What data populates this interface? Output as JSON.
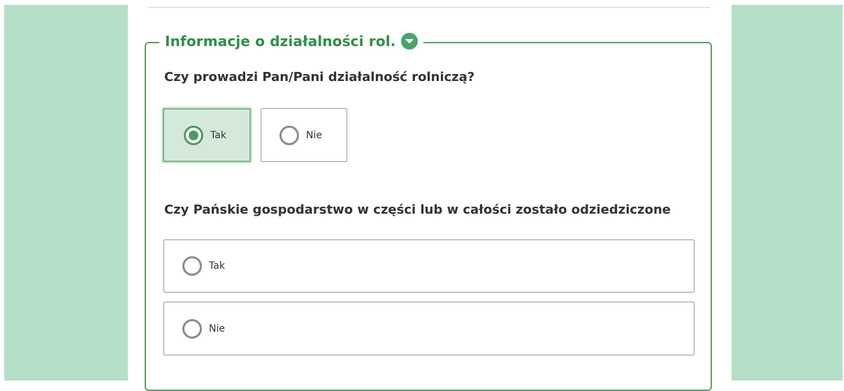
{
  "section": {
    "legend_title": "Informacje o działalności rol."
  },
  "questions": [
    {
      "text": "Czy prowadzi Pan/Pani działalność rolniczą?",
      "options": [
        {
          "label": "Tak",
          "selected": true
        },
        {
          "label": "Nie",
          "selected": false
        }
      ]
    },
    {
      "text": "Czy Pańskie gospodarstwo w części lub w całości zostało odziedziczone",
      "options": [
        {
          "label": "Tak",
          "selected": false
        },
        {
          "label": "Nie",
          "selected": false
        }
      ]
    }
  ],
  "colors": {
    "accent": "#2f8f45",
    "page_background": "#b6dfc8",
    "selected_background": "#d5e9db"
  },
  "icons": {
    "legend_toggle": "chevron-down-icon"
  }
}
